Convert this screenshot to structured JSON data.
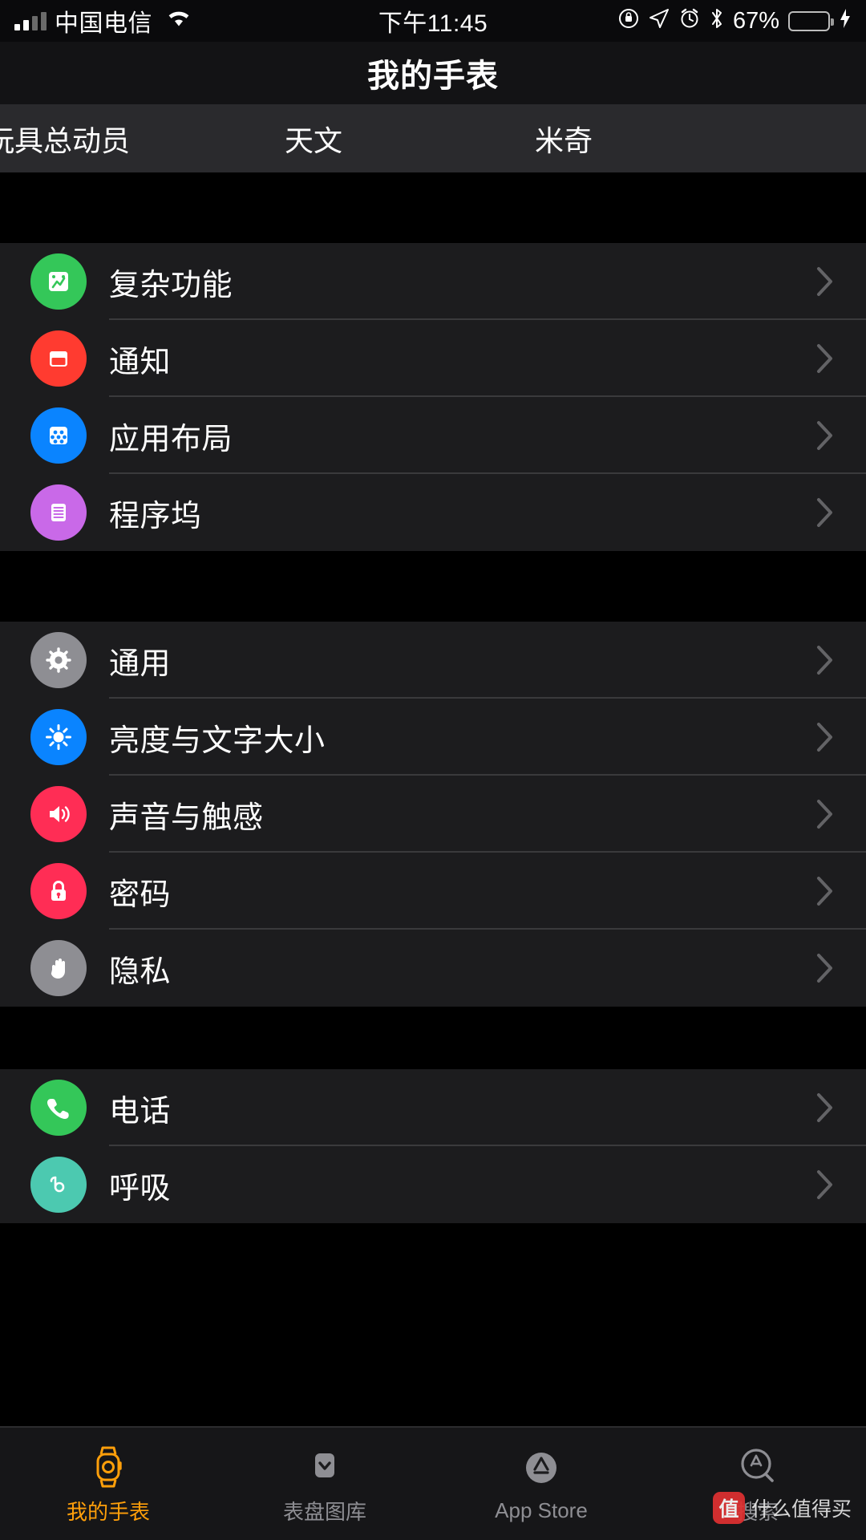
{
  "status_bar": {
    "carrier": "中国电信",
    "time": "下午11:45",
    "battery_percent": "67%",
    "battery_level": 67,
    "icons": [
      "signal-bars",
      "wifi-icon",
      "rotation-lock-icon",
      "location-arrow-icon",
      "alarm-clock-icon",
      "bluetooth-icon",
      "battery-icon",
      "charging-bolt-icon"
    ]
  },
  "nav": {
    "title": "我的手表"
  },
  "faces": [
    {
      "label": "玩具总动员"
    },
    {
      "label": "天文"
    },
    {
      "label": "米奇"
    }
  ],
  "groups": [
    {
      "rows": [
        {
          "label": "复杂功能",
          "icon": "complications-icon",
          "color": "#34c759"
        },
        {
          "label": "通知",
          "icon": "notifications-icon",
          "color": "#ff3b30"
        },
        {
          "label": "应用布局",
          "icon": "app-layout-icon",
          "color": "#0a84ff"
        },
        {
          "label": "程序坞",
          "icon": "dock-icon",
          "color": "#c969e8"
        }
      ]
    },
    {
      "rows": [
        {
          "label": "通用",
          "icon": "gear-icon",
          "color": "#8e8e93"
        },
        {
          "label": "亮度与文字大小",
          "icon": "brightness-icon",
          "color": "#0a84ff"
        },
        {
          "label": "声音与触感",
          "icon": "sound-icon",
          "color": "#ff2d55"
        },
        {
          "label": "密码",
          "icon": "lock-icon",
          "color": "#ff2d55"
        },
        {
          "label": "隐私",
          "icon": "privacy-hand-icon",
          "color": "#8e8e93"
        }
      ]
    },
    {
      "rows": [
        {
          "label": "电话",
          "icon": "phone-icon",
          "color": "#34c759"
        },
        {
          "label": "呼吸",
          "icon": "breathe-icon",
          "color": "#4cc9b0"
        }
      ]
    }
  ],
  "tabbar": {
    "items": [
      {
        "label": "我的手表",
        "icon": "watch-icon",
        "active": true
      },
      {
        "label": "表盘图库",
        "icon": "face-gallery-icon",
        "active": false
      },
      {
        "label": "App Store",
        "icon": "app-store-icon",
        "active": false
      },
      {
        "label": "搜索",
        "icon": "search-app-icon",
        "active": false
      }
    ]
  },
  "watermark": {
    "badge": "值",
    "text": "什么值得买"
  },
  "colors": {
    "accent": "#ff9f0a",
    "group_bg": "#1c1c1e",
    "page_bg": "#000000",
    "separator": "#3a3a3c"
  }
}
